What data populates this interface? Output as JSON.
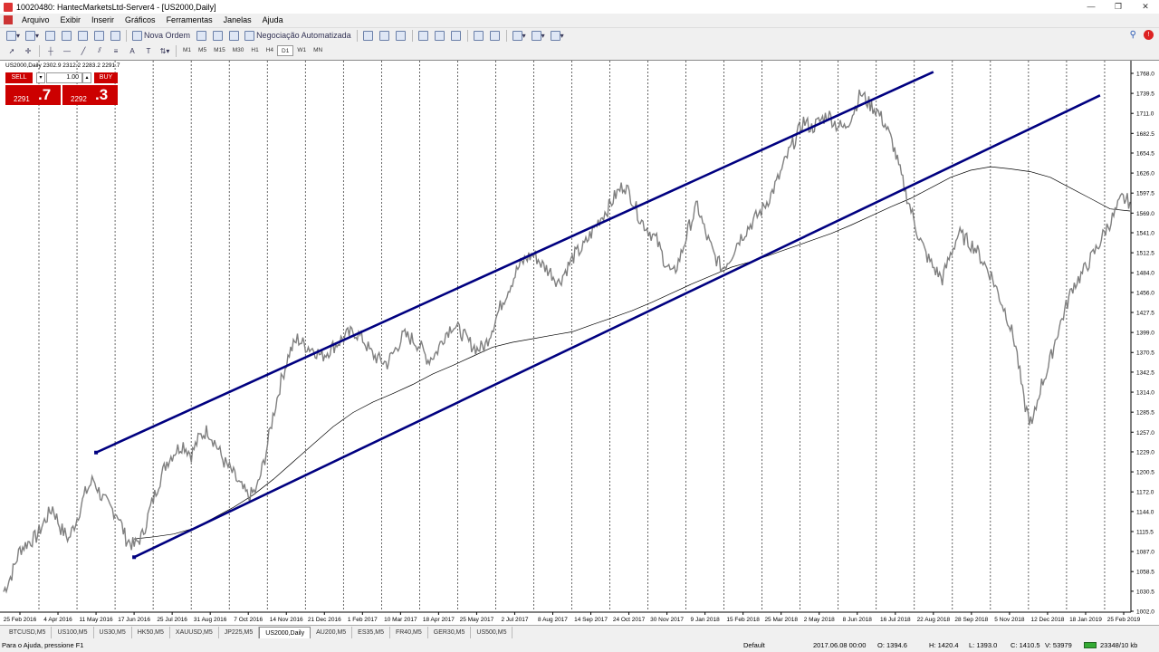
{
  "window": {
    "title": "10020480: HantecMarketsLtd-Server4 - [US2000,Daily]",
    "controls": [
      "—",
      "❐",
      "✕"
    ]
  },
  "menu": [
    "Arquivo",
    "Exibir",
    "Inserir",
    "Gráficos",
    "Ferramentas",
    "Janelas",
    "Ajuda"
  ],
  "toolbar": {
    "new_order": "Nova Ordem",
    "auto_trading": "Negociação Automatizada",
    "timeframes": [
      "M1",
      "M5",
      "M15",
      "M30",
      "H1",
      "H4",
      "D1",
      "W1",
      "MN"
    ],
    "active_timeframe": "D1"
  },
  "chart_info": {
    "symbol_line": "US2000,Daily   2302.9 2312.2 2283.2 2291.7"
  },
  "trade_panel": {
    "sell_label": "SELL",
    "buy_label": "BUY",
    "lot": "1.00",
    "bid_small": "2291",
    "bid_big": ".7",
    "ask_small": "2292",
    "ask_big": ".3"
  },
  "chart_data": {
    "type": "line",
    "title": "",
    "x_labels": [
      "25 Feb 2016",
      "4 Apr 2016",
      "11 May 2016",
      "17 Jun 2016",
      "25 Jul 2016",
      "31 Aug 2016",
      "7 Oct 2016",
      "14 Nov 2016",
      "21 Dec 2016",
      "1 Feb 2017",
      "10 Mar 2017",
      "18 Apr 2017",
      "25 May 2017",
      "2 Jul 2017",
      "8 Aug 2017",
      "14 Sep 2017",
      "24 Oct 2017",
      "30 Nov 2017",
      "9 Jan 2018",
      "15 Feb 2018",
      "25 Mar 2018",
      "2 May 2018",
      "8 Jun 2018",
      "16 Jul 2018",
      "22 Aug 2018",
      "28 Sep 2018",
      "5 Nov 2018",
      "12 Dec 2018",
      "18 Jan 2019",
      "25 Feb 2019"
    ],
    "y_ticks": [
      "1768.0",
      "1739.5",
      "1711.0",
      "1682.5",
      "1654.5",
      "1626.0",
      "1597.5",
      "1569.0",
      "1541.0",
      "1512.5",
      "1484.0",
      "1456.0",
      "1427.5",
      "1399.0",
      "1370.5",
      "1342.5",
      "1314.0",
      "1285.5",
      "1257.0",
      "1229.0",
      "1200.5",
      "1172.0",
      "1144.0",
      "1115.5",
      "1087.0",
      "1058.5",
      "1030.5",
      "1002.0"
    ],
    "ylim": [
      1002.0,
      1768.0
    ],
    "grid": "vertical dotted",
    "series": [
      {
        "values": [
          1030,
          1055,
          1090,
          1100,
          1108,
          1130,
          1150,
          1120,
          1105,
          1135,
          1170,
          1190,
          1165,
          1150,
          1140,
          1105,
          1095,
          1110,
          1150,
          1185,
          1215,
          1230,
          1240,
          1225,
          1250,
          1260,
          1240,
          1215,
          1200,
          1180,
          1165,
          1175,
          1220,
          1280,
          1330,
          1370,
          1390,
          1380,
          1375,
          1365,
          1375,
          1385,
          1395,
          1400,
          1390,
          1370,
          1360,
          1355,
          1375,
          1395,
          1390,
          1380,
          1360,
          1370,
          1395,
          1410,
          1400,
          1385,
          1375,
          1380,
          1410,
          1440,
          1465,
          1490,
          1505,
          1510,
          1495,
          1485,
          1470,
          1490,
          1510,
          1520,
          1540,
          1560,
          1575,
          1595,
          1610,
          1590,
          1560,
          1545,
          1530,
          1500,
          1480,
          1510,
          1550,
          1580,
          1540,
          1510,
          1490,
          1505,
          1530,
          1545,
          1560,
          1575,
          1595,
          1620,
          1650,
          1675,
          1700,
          1690,
          1700,
          1710,
          1695,
          1690,
          1710,
          1740,
          1725,
          1715,
          1695,
          1665,
          1620,
          1580,
          1540,
          1510,
          1490,
          1475,
          1510,
          1540,
          1530,
          1520,
          1500,
          1480,
          1450,
          1420,
          1380,
          1300,
          1265,
          1320,
          1350,
          1395,
          1430,
          1465,
          1480,
          1500,
          1520,
          1545,
          1565,
          1590,
          1585
        ]
      },
      {
        "name": "",
        "values": [
          1105,
          1108,
          1112,
          1120,
          1135,
          1150,
          1168,
          1190,
          1215,
          1240,
          1265,
          1285,
          1300,
          1312,
          1325,
          1340,
          1352,
          1365,
          1378,
          1385,
          1390,
          1395,
          1400,
          1410,
          1420,
          1430,
          1442,
          1455,
          1468,
          1480,
          1492,
          1500,
          1510,
          1520,
          1530,
          1540,
          1552,
          1565,
          1578,
          1590,
          1605,
          1620,
          1630,
          1635,
          1632,
          1628,
          1620,
          1605,
          1590,
          1575,
          1572
        ]
      }
    ],
    "channel_lines": [
      {
        "name": "upper",
        "from": [
          "11 May 2016",
          1228
        ],
        "to": [
          "22 Aug 2018",
          1770
        ]
      },
      {
        "name": "lower",
        "from": [
          "17 Jun 2016",
          1079
        ],
        "to": [
          "5 Nov 2018",
          1675
        ]
      }
    ]
  },
  "tabs": [
    "BTCUSD,M5",
    "US100,M5",
    "US30,M5",
    "HK50,M5",
    "XAUUSD,M5",
    "JP225,M5",
    "US2000,Daily",
    "AU200,M5",
    "ES35,M5",
    "FR40,M5",
    "GER30,M5",
    "US500,M5"
  ],
  "active_tab": "US2000,Daily",
  "status": {
    "help": "Para o Ajuda, pressione F1",
    "profile": "Default",
    "datetime": "2017.06.08 00:00",
    "open": "O: 1394.6",
    "high": "H: 1420.4",
    "low": "L: 1393.0",
    "close": "C: 1410.5",
    "volume": "V: 53979",
    "traffic": "23348/10 kb"
  }
}
